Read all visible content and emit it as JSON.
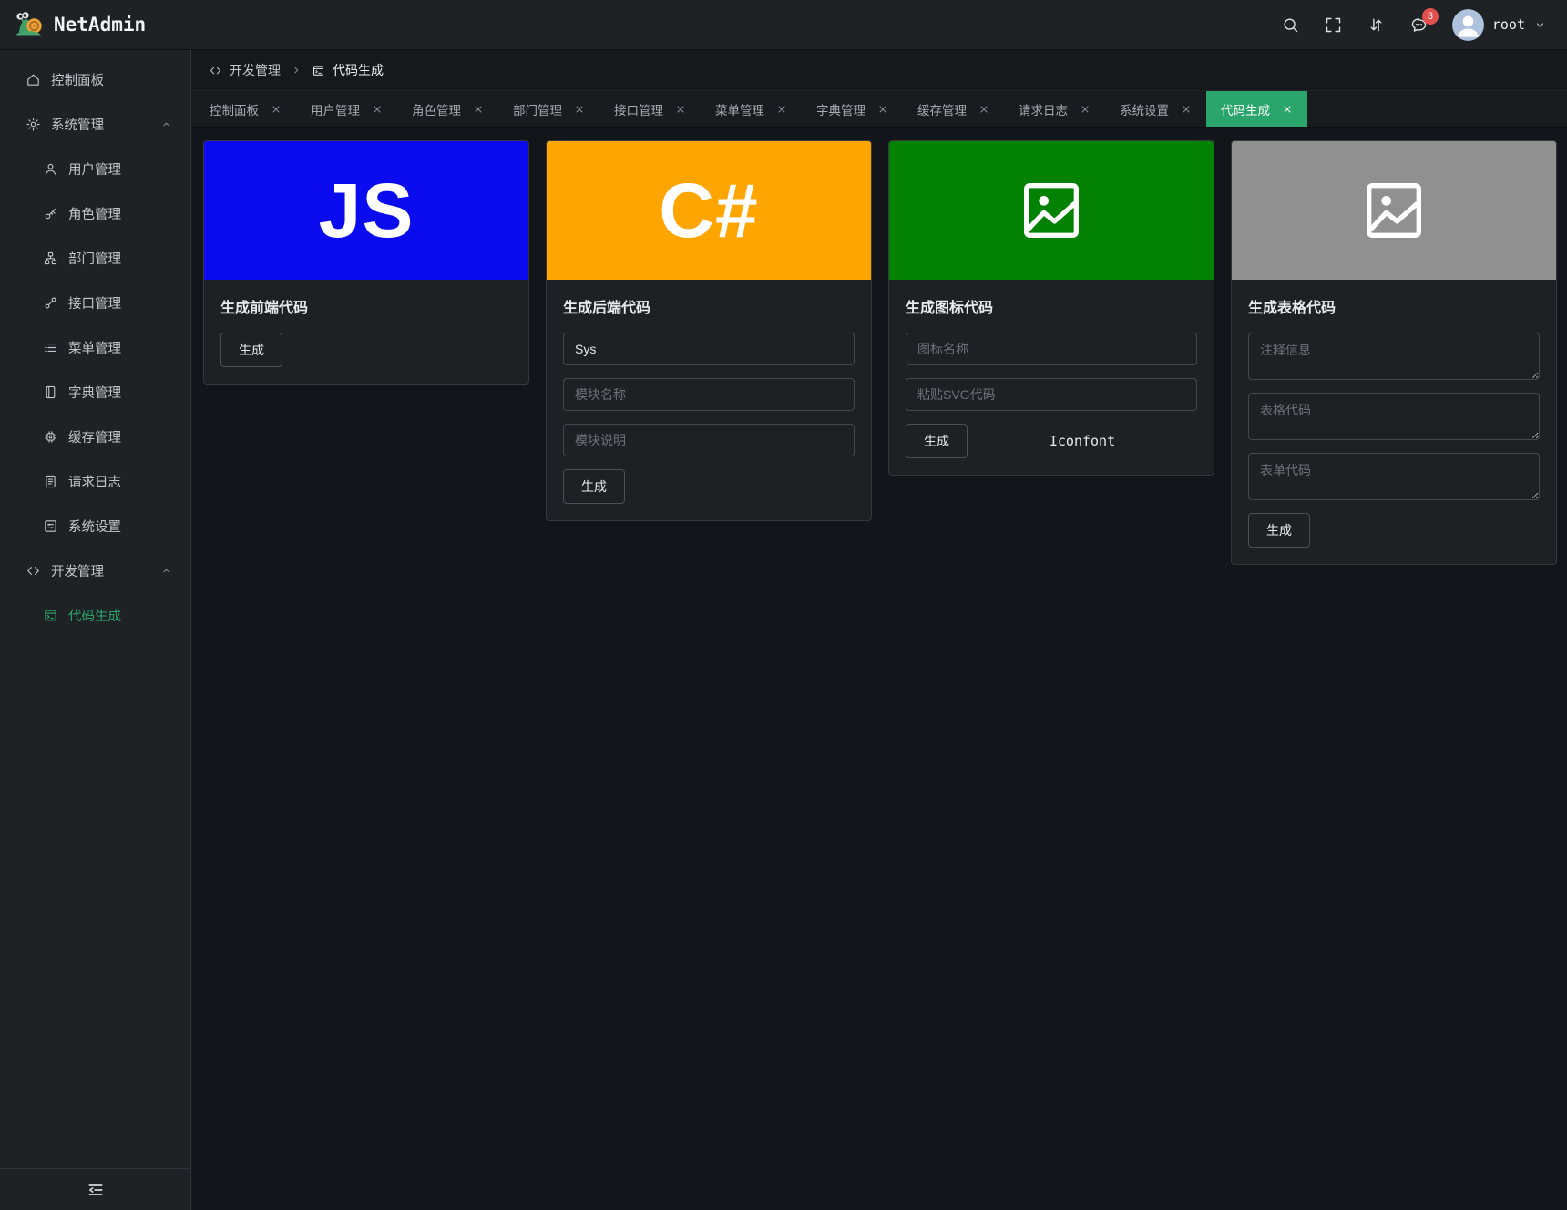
{
  "colors": {
    "accent_green": "#2aa56b",
    "badge_red": "#e25050",
    "banner_blue": "#0b0bef",
    "banner_orange": "#ffa500",
    "banner_green": "#028102",
    "banner_gray": "#909090"
  },
  "header": {
    "brand": "NetAdmin",
    "badge_count": "3",
    "user_name": "root"
  },
  "sidebar": {
    "items": [
      {
        "key": "dashboard",
        "icon": "home-icon",
        "label": "控制面板"
      },
      {
        "key": "system",
        "icon": "gear-icon",
        "label": "系统管理",
        "expanded": true,
        "children": [
          {
            "key": "users",
            "icon": "user-icon",
            "label": "用户管理"
          },
          {
            "key": "roles",
            "icon": "key-icon",
            "label": "角色管理"
          },
          {
            "key": "departments",
            "icon": "org-icon",
            "label": "部门管理"
          },
          {
            "key": "apis",
            "icon": "link-icon",
            "label": "接口管理"
          },
          {
            "key": "menus",
            "icon": "list-icon",
            "label": "菜单管理"
          },
          {
            "key": "dictionaries",
            "icon": "book-icon",
            "label": "字典管理"
          },
          {
            "key": "cache",
            "icon": "cpu-icon",
            "label": "缓存管理"
          },
          {
            "key": "request-logs",
            "icon": "doc-icon",
            "label": "请求日志"
          },
          {
            "key": "settings",
            "icon": "panel-icon",
            "label": "系统设置"
          }
        ]
      },
      {
        "key": "development",
        "icon": "code-icon",
        "label": "开发管理",
        "expanded": true,
        "children": [
          {
            "key": "code-generation",
            "icon": "terminal-icon",
            "label": "代码生成",
            "active": true
          }
        ]
      }
    ]
  },
  "breadcrumb": {
    "items": [
      {
        "icon": "code-icon",
        "label": "开发管理"
      },
      {
        "icon": "terminal-icon",
        "label": "代码生成"
      }
    ]
  },
  "tabs": [
    {
      "key": "dashboard",
      "label": "控制面板"
    },
    {
      "key": "users",
      "label": "用户管理"
    },
    {
      "key": "roles",
      "label": "角色管理"
    },
    {
      "key": "departments",
      "label": "部门管理"
    },
    {
      "key": "apis",
      "label": "接口管理"
    },
    {
      "key": "menus",
      "label": "菜单管理"
    },
    {
      "key": "dictionaries",
      "label": "字典管理"
    },
    {
      "key": "cache",
      "label": "缓存管理"
    },
    {
      "key": "request-logs",
      "label": "请求日志"
    },
    {
      "key": "settings",
      "label": "系统设置"
    },
    {
      "key": "code-generation",
      "label": "代码生成",
      "active": true
    }
  ],
  "cards": [
    {
      "key": "frontend",
      "title": "生成前端代码",
      "banner": {
        "type": "text",
        "text": "JS",
        "color": "#0b0bef"
      },
      "button_label": "生成"
    },
    {
      "key": "backend",
      "title": "生成后端代码",
      "banner": {
        "type": "text",
        "text": "C#",
        "color": "#ffa500"
      },
      "inputs": [
        {
          "value": "Sys",
          "placeholder": ""
        },
        {
          "value": "",
          "placeholder": "模块名称"
        },
        {
          "value": "",
          "placeholder": "模块说明"
        }
      ],
      "button_label": "生成"
    },
    {
      "key": "icon",
      "title": "生成图标代码",
      "banner": {
        "type": "image",
        "color": "#028102"
      },
      "inputs": [
        {
          "value": "",
          "placeholder": "图标名称"
        },
        {
          "value": "",
          "placeholder": "粘贴SVG代码"
        }
      ],
      "button_label": "生成",
      "link_label": "Iconfont"
    },
    {
      "key": "table",
      "title": "生成表格代码",
      "banner": {
        "type": "image",
        "color": "#909090"
      },
      "textareas": [
        {
          "placeholder": "注释信息"
        },
        {
          "placeholder": "表格代码"
        },
        {
          "placeholder": "表单代码"
        }
      ],
      "button_label": "生成"
    }
  ]
}
